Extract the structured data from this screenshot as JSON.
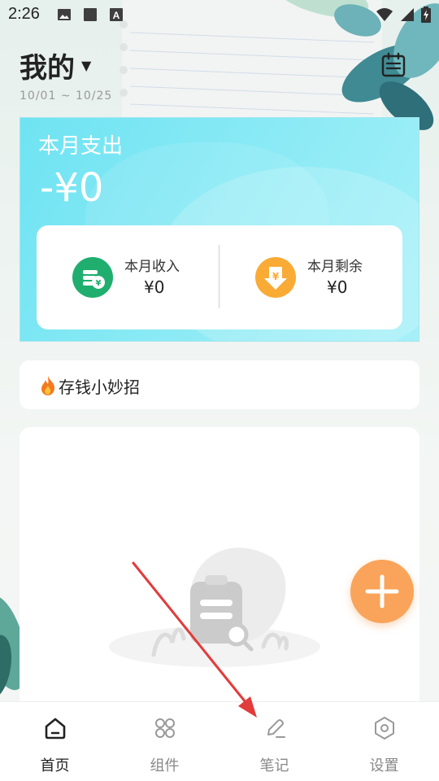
{
  "status_bar": {
    "time": "2:26",
    "icons_left": [
      "image-icon",
      "square-icon",
      "text-a-icon"
    ],
    "icons_right": [
      "wifi-icon",
      "signal-icon",
      "battery-charging-icon"
    ]
  },
  "header": {
    "title": "我的",
    "title_caret": "▼",
    "date_range": "10/01 ~ 10/25",
    "calendar_icon": "calendar-list-icon"
  },
  "expense_card": {
    "label": "本月支出",
    "value": "-¥0",
    "income_label": "本月收入",
    "income_value": "¥0",
    "remaining_label": "本月剩余",
    "remaining_value": "¥0",
    "income_icon": "coins-icon",
    "remaining_icon": "yen-down-icon"
  },
  "tips": {
    "label": "存钱小妙招",
    "icon": "fire-icon"
  },
  "content": {
    "empty_icon": "empty-clipboard-search-icon"
  },
  "fab": {
    "icon": "plus-icon"
  },
  "bottom_nav": {
    "items": [
      {
        "label": "首页",
        "icon": "home-icon",
        "active": true
      },
      {
        "label": "组件",
        "icon": "grid-icon",
        "active": false
      },
      {
        "label": "笔记",
        "icon": "pen-icon",
        "active": false
      },
      {
        "label": "设置",
        "icon": "hexagon-gear-icon",
        "active": false
      }
    ]
  },
  "colors": {
    "card_accent": "#6fe3f2",
    "income_green": "#1fae6e",
    "remaining_orange": "#f9ab36",
    "fab_orange": "#f9a45a",
    "annotation_red": "#e23b3b"
  }
}
